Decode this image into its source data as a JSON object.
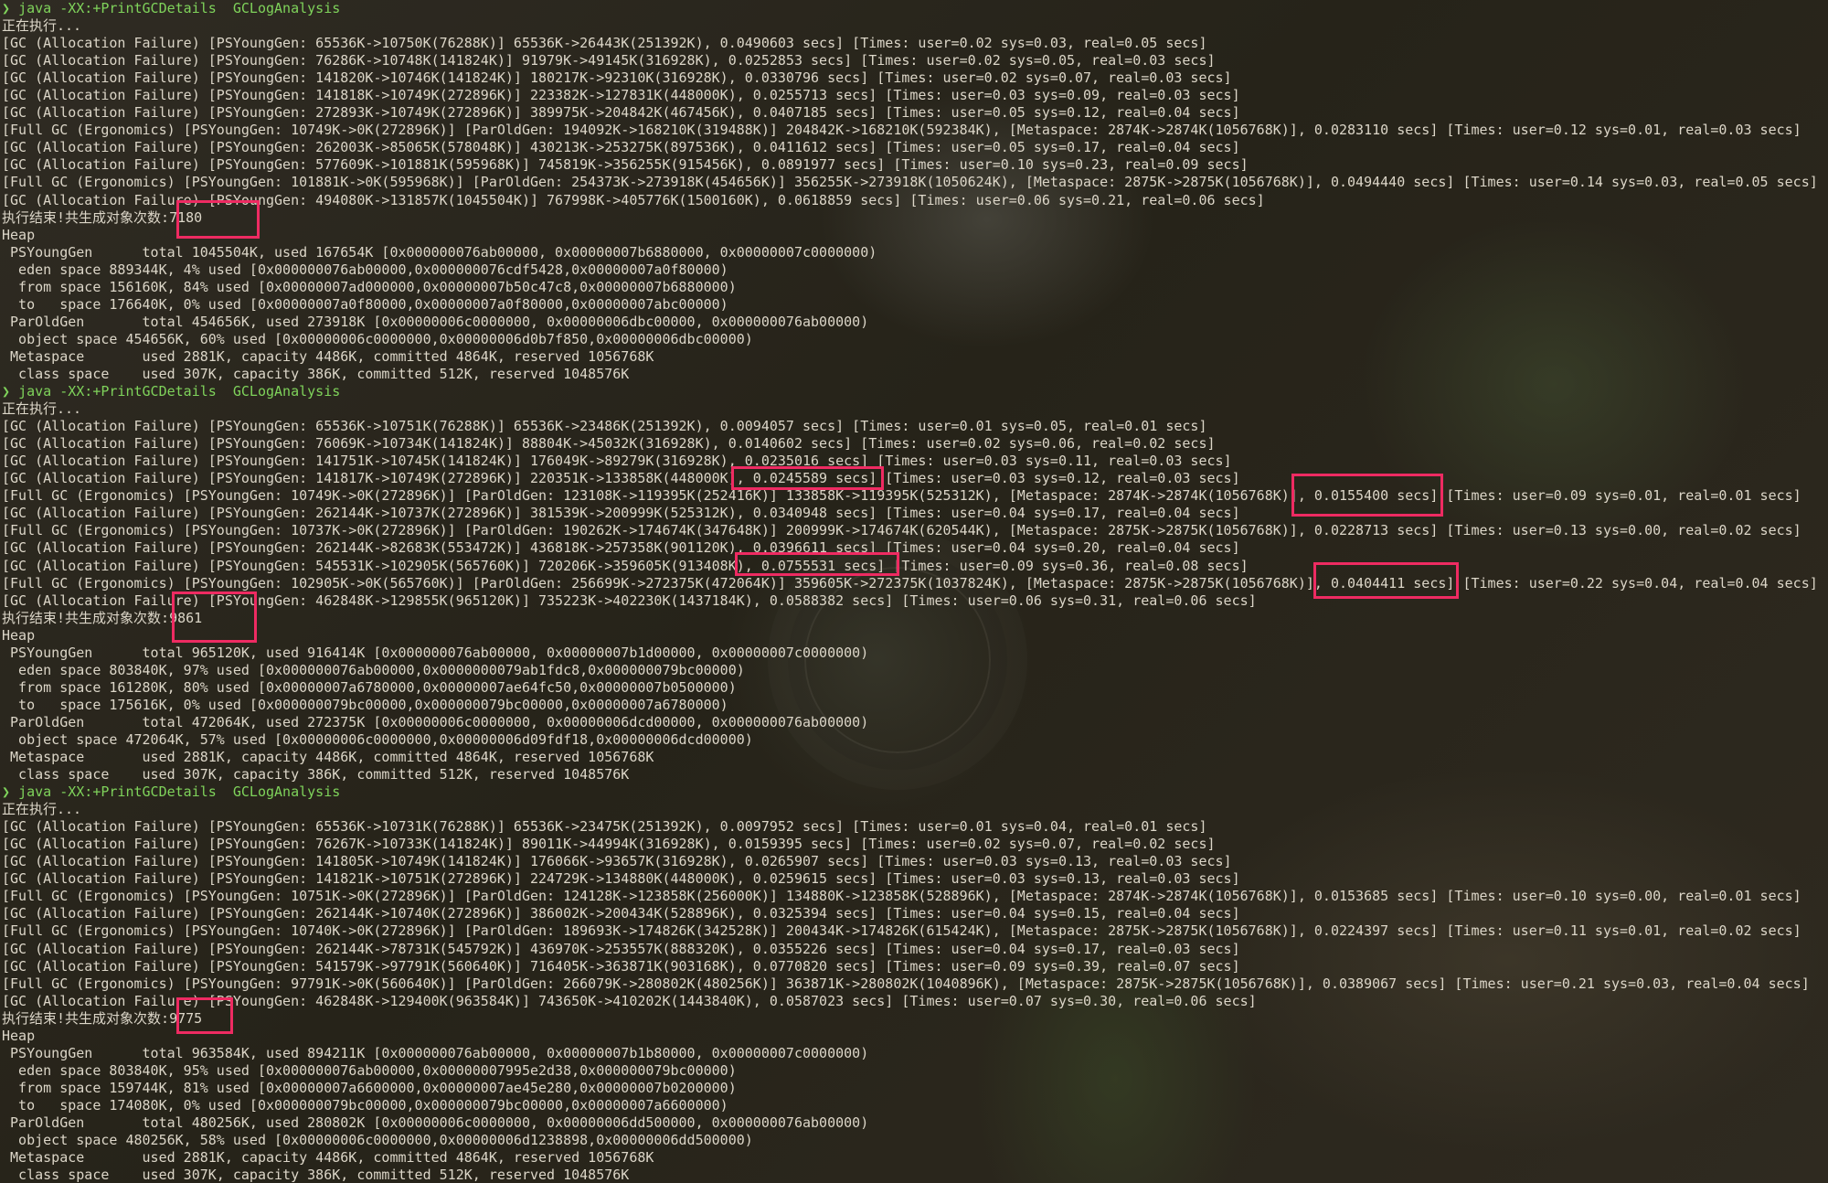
{
  "theme": {
    "background": "#2d2a22",
    "text": "#dcd6c8",
    "prompt_color": "#7fd35b",
    "highlight_color": "#ee2b62"
  },
  "runs": [
    {
      "prompt": {
        "symbol": "❯",
        "command": "java -XX:+PrintGCDetails  GCLogAnalysis"
      },
      "lines": [
        "正在执行...",
        "[GC (Allocation Failure) [PSYoungGen: 65536K->10750K(76288K)] 65536K->26443K(251392K), 0.0490603 secs] [Times: user=0.02 sys=0.03, real=0.05 secs]",
        "[GC (Allocation Failure) [PSYoungGen: 76286K->10748K(141824K)] 91979K->49145K(316928K), 0.0252853 secs] [Times: user=0.02 sys=0.05, real=0.03 secs]",
        "[GC (Allocation Failure) [PSYoungGen: 141820K->10746K(141824K)] 180217K->92310K(316928K), 0.0330796 secs] [Times: user=0.02 sys=0.07, real=0.03 secs]",
        "[GC (Allocation Failure) [PSYoungGen: 141818K->10749K(272896K)] 223382K->127831K(448000K), 0.0255713 secs] [Times: user=0.03 sys=0.09, real=0.03 secs]",
        "[GC (Allocation Failure) [PSYoungGen: 272893K->10749K(272896K)] 389975K->204842K(467456K), 0.0407185 secs] [Times: user=0.05 sys=0.12, real=0.04 secs]",
        "[Full GC (Ergonomics) [PSYoungGen: 10749K->0K(272896K)] [ParOldGen: 194092K->168210K(319488K)] 204842K->168210K(592384K), [Metaspace: 2874K->2874K(1056768K)], 0.0283110 secs] [Times: user=0.12 sys=0.01, real=0.03 secs]",
        "[GC (Allocation Failure) [PSYoungGen: 262003K->85065K(578048K)] 430213K->253275K(897536K), 0.0411612 secs] [Times: user=0.05 sys=0.17, real=0.04 secs]",
        "[GC (Allocation Failure) [PSYoungGen: 577609K->101881K(595968K)] 745819K->356255K(915456K), 0.0891977 secs] [Times: user=0.10 sys=0.23, real=0.09 secs]",
        "[Full GC (Ergonomics) [PSYoungGen: 101881K->0K(595968K)] [ParOldGen: 254373K->273918K(454656K)] 356255K->273918K(1050624K), [Metaspace: 2875K->2875K(1056768K)], 0.0494440 secs] [Times: user=0.14 sys=0.03, real=0.05 secs]",
        "[GC (Allocation Failure) [PSYoungGen: 494080K->131857K(1045504K)] 767998K->405776K(1500160K), 0.0618859 secs] [Times: user=0.06 sys=0.21, real=0.06 secs]",
        "执行结束!共生成对象次数:7180",
        "Heap",
        " PSYoungGen      total 1045504K, used 167654K [0x000000076ab00000, 0x00000007b6880000, 0x00000007c0000000)",
        "  eden space 889344K, 4% used [0x000000076ab00000,0x000000076cdf5428,0x00000007a0f80000)",
        "  from space 156160K, 84% used [0x00000007ad000000,0x00000007b50c47c8,0x00000007b6880000)",
        "  to   space 176640K, 0% used [0x00000007a0f80000,0x00000007a0f80000,0x00000007abc00000)",
        " ParOldGen       total 454656K, used 273918K [0x00000006c0000000, 0x00000006dbc00000, 0x000000076ab00000)",
        "  object space 454656K, 60% used [0x00000006c0000000,0x00000006d0b7f850,0x00000006dbc00000)",
        " Metaspace       used 2881K, capacity 4486K, committed 4864K, reserved 1056768K",
        "  class space    used 307K, capacity 386K, committed 512K, reserved 1048576K"
      ]
    },
    {
      "prompt": {
        "symbol": "❯",
        "command": "java -XX:+PrintGCDetails  GCLogAnalysis"
      },
      "lines": [
        "正在执行...",
        "[GC (Allocation Failure) [PSYoungGen: 65536K->10751K(76288K)] 65536K->23486K(251392K), 0.0094057 secs] [Times: user=0.01 sys=0.05, real=0.01 secs]",
        "[GC (Allocation Failure) [PSYoungGen: 76069K->10734K(141824K)] 88804K->45032K(316928K), 0.0140602 secs] [Times: user=0.02 sys=0.06, real=0.02 secs]",
        "[GC (Allocation Failure) [PSYoungGen: 141751K->10745K(141824K)] 176049K->89279K(316928K), 0.0235016 secs] [Times: user=0.03 sys=0.11, real=0.03 secs]",
        "[GC (Allocation Failure) [PSYoungGen: 141817K->10749K(272896K)] 220351K->133858K(448000K), 0.0245589 secs] [Times: user=0.03 sys=0.12, real=0.03 secs]",
        "[Full GC (Ergonomics) [PSYoungGen: 10749K->0K(272896K)] [ParOldGen: 123108K->119395K(252416K)] 133858K->119395K(525312K), [Metaspace: 2874K->2874K(1056768K)], 0.0155400 secs] [Times: user=0.09 sys=0.01, real=0.01 secs]",
        "[GC (Allocation Failure) [PSYoungGen: 262144K->10737K(272896K)] 381539K->200999K(525312K), 0.0340948 secs] [Times: user=0.04 sys=0.17, real=0.04 secs]",
        "[Full GC (Ergonomics) [PSYoungGen: 10737K->0K(272896K)] [ParOldGen: 190262K->174674K(347648K)] 200999K->174674K(620544K), [Metaspace: 2875K->2875K(1056768K)], 0.0228713 secs] [Times: user=0.13 sys=0.00, real=0.02 secs]",
        "[GC (Allocation Failure) [PSYoungGen: 262144K->82683K(553472K)] 436818K->257358K(901120K), 0.0396611 secs] [Times: user=0.04 sys=0.20, real=0.04 secs]",
        "[GC (Allocation Failure) [PSYoungGen: 545531K->102905K(565760K)] 720206K->359605K(913408K), 0.0755531 secs] [Times: user=0.09 sys=0.36, real=0.08 secs]",
        "[Full GC (Ergonomics) [PSYoungGen: 102905K->0K(565760K)] [ParOldGen: 256699K->272375K(472064K)] 359605K->272375K(1037824K), [Metaspace: 2875K->2875K(1056768K)], 0.0404411 secs] [Times: user=0.22 sys=0.04, real=0.04 secs]",
        "[GC (Allocation Failure) [PSYoungGen: 462848K->129855K(965120K)] 735223K->402230K(1437184K), 0.0588382 secs] [Times: user=0.06 sys=0.31, real=0.06 secs]",
        "执行结束!共生成对象次数:9861",
        "Heap",
        " PSYoungGen      total 965120K, used 916414K [0x000000076ab00000, 0x00000007b1d00000, 0x00000007c0000000)",
        "  eden space 803840K, 97% used [0x000000076ab00000,0x0000000079ab1fdc8,0x000000079bc00000)",
        "  from space 161280K, 80% used [0x00000007a6780000,0x00000007ae64fc50,0x00000007b0500000)",
        "  to   space 175616K, 0% used [0x000000079bc00000,0x000000079bc00000,0x00000007a6780000)",
        " ParOldGen       total 472064K, used 272375K [0x00000006c0000000, 0x00000006dcd00000, 0x000000076ab00000)",
        "  object space 472064K, 57% used [0x00000006c0000000,0x00000006d09fdf18,0x00000006dcd00000)",
        " Metaspace       used 2881K, capacity 4486K, committed 4864K, reserved 1056768K",
        "  class space    used 307K, capacity 386K, committed 512K, reserved 1048576K"
      ]
    },
    {
      "prompt": {
        "symbol": "❯",
        "command": "java -XX:+PrintGCDetails  GCLogAnalysis"
      },
      "lines": [
        "正在执行...",
        "[GC (Allocation Failure) [PSYoungGen: 65536K->10731K(76288K)] 65536K->23475K(251392K), 0.0097952 secs] [Times: user=0.01 sys=0.04, real=0.01 secs]",
        "[GC (Allocation Failure) [PSYoungGen: 76267K->10733K(141824K)] 89011K->44994K(316928K), 0.0159395 secs] [Times: user=0.02 sys=0.07, real=0.02 secs]",
        "[GC (Allocation Failure) [PSYoungGen: 141805K->10749K(141824K)] 176066K->93657K(316928K), 0.0265907 secs] [Times: user=0.03 sys=0.13, real=0.03 secs]",
        "[GC (Allocation Failure) [PSYoungGen: 141821K->10751K(272896K)] 224729K->134880K(448000K), 0.0259615 secs] [Times: user=0.03 sys=0.13, real=0.03 secs]",
        "[Full GC (Ergonomics) [PSYoungGen: 10751K->0K(272896K)] [ParOldGen: 124128K->123858K(256000K)] 134880K->123858K(528896K), [Metaspace: 2874K->2874K(1056768K)], 0.0153685 secs] [Times: user=0.10 sys=0.00, real=0.01 secs]",
        "[GC (Allocation Failure) [PSYoungGen: 262144K->10740K(272896K)] 386002K->200434K(528896K), 0.0325394 secs] [Times: user=0.04 sys=0.15, real=0.04 secs]",
        "[Full GC (Ergonomics) [PSYoungGen: 10740K->0K(272896K)] [ParOldGen: 189693K->174826K(342528K)] 200434K->174826K(615424K), [Metaspace: 2875K->2875K(1056768K)], 0.0224397 secs] [Times: user=0.11 sys=0.01, real=0.02 secs]",
        "[GC (Allocation Failure) [PSYoungGen: 262144K->78731K(545792K)] 436970K->253557K(888320K), 0.0355226 secs] [Times: user=0.04 sys=0.17, real=0.03 secs]",
        "[GC (Allocation Failure) [PSYoungGen: 541579K->97791K(560640K)] 716405K->363871K(903168K), 0.0770820 secs] [Times: user=0.09 sys=0.39, real=0.07 secs]",
        "[Full GC (Ergonomics) [PSYoungGen: 97791K->0K(560640K)] [ParOldGen: 266079K->280802K(480256K)] 363871K->280802K(1040896K), [Metaspace: 2875K->2875K(1056768K)], 0.0389067 secs] [Times: user=0.21 sys=0.03, real=0.04 secs]",
        "[GC (Allocation Failure) [PSYoungGen: 462848K->129400K(963584K)] 743650K->410202K(1443840K), 0.0587023 secs] [Times: user=0.07 sys=0.30, real=0.06 secs]",
        "执行结束!共生成对象次数:9775",
        "Heap",
        " PSYoungGen      total 963584K, used 894211K [0x000000076ab00000, 0x00000007b1b80000, 0x00000007c0000000)",
        "  eden space 803840K, 95% used [0x000000076ab00000,0x00000007995e2d38,0x000000079bc00000)",
        "  from space 159744K, 81% used [0x00000007a6600000,0x00000007ae45e280,0x00000007b0200000)",
        "  to   space 174080K, 0% used [0x000000079bc00000,0x000000079bc00000,0x00000007a6600000)",
        " ParOldGen       total 480256K, used 280802K [0x00000006c0000000, 0x00000006dd500000, 0x000000076ab00000)",
        "  object space 480256K, 58% used [0x00000006c0000000,0x00000006d1238898,0x00000006dd500000)",
        " Metaspace       used 2881K, capacity 4486K, committed 4864K, reserved 1056768K",
        "  class space    used 307K, capacity 386K, committed 512K, reserved 1048576K"
      ]
    }
  ]
}
